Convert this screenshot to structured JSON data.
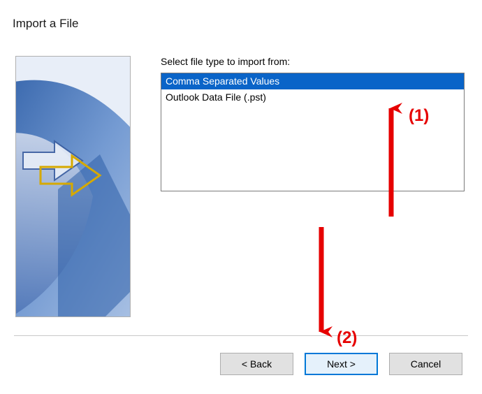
{
  "dialog": {
    "title": "Import a File"
  },
  "content": {
    "list_label": "Select file type to import from:",
    "file_types": [
      {
        "label": "Comma Separated Values",
        "selected": true
      },
      {
        "label": "Outlook Data File (.pst)",
        "selected": false
      }
    ]
  },
  "buttons": {
    "back": "< Back",
    "next": "Next >",
    "cancel": "Cancel"
  },
  "annotations": {
    "label1": "(1)",
    "label2": "(2)"
  }
}
